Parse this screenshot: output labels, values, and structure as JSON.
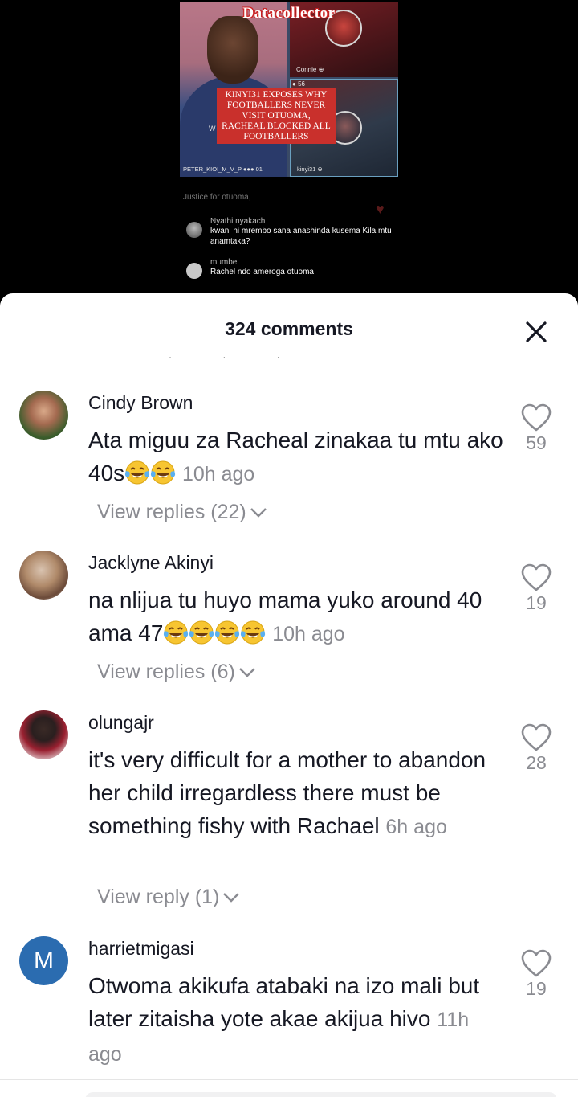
{
  "video": {
    "channel_title": "Datacollector",
    "banner_text": "KINYI31 EXPOSES WHY FOOTBALLERS NEVER VISIT OTUOMA, RACHEAL BLOCKED ALL FOOTBALLERS",
    "guest_label": "Connie",
    "guest_count": "56",
    "left_partial": "W",
    "host_label": "PETER_KIOI_M_V_P",
    "host_suffix": "01",
    "cohost_label": "kinyi31",
    "live_comments": [
      {
        "user": "",
        "text": "Justice for otuoma,"
      },
      {
        "user": "Nyathi nyakach",
        "text": "kwani ni mrembo sana anashinda kusema Kila mtu anamtaka?"
      },
      {
        "user": "mumbe",
        "text": "Rachel ndo ameroga otuoma"
      }
    ]
  },
  "sheet": {
    "title": "324 comments"
  },
  "comments": [
    {
      "user": "Cindy Brown",
      "text": "Ata miguu za Racheal zinakaa tu mtu ako 40s",
      "emoji_count": 2,
      "time": "10h ago",
      "replies": "View replies (22)",
      "likes": "59"
    },
    {
      "user": "Jacklyne Akinyi",
      "text": "na nlijua tu huyo mama yuko around 40 ama 47",
      "emoji_count": 4,
      "time": "10h ago",
      "replies": "View replies (6)",
      "likes": "19"
    },
    {
      "user": "olungajr",
      "text": "it's very difficult for a mother to abandon her child irregardless there must be something fishy with Rachael",
      "emoji_count": 0,
      "time": "6h ago",
      "replies": "View reply (1)",
      "likes": "28"
    },
    {
      "user": "harrietmigasi",
      "avatar_letter": "M",
      "text": "Otwoma akikufa atabaki na izo mali but later zitaisha yote akae akijua hivo",
      "emoji_count": 0,
      "time": "11h ago",
      "replies": "",
      "likes": "19"
    }
  ],
  "icons": {
    "like": "heart-outline-icon",
    "close": "close-icon",
    "expand": "chevron-down-icon",
    "emoji": "face-with-tears-of-joy-icon"
  },
  "colors": {
    "text_primary": "#161823",
    "text_secondary": "#8a8b91",
    "avatar_blue": "#2b6cb0",
    "banner_red": "#c9302c"
  }
}
